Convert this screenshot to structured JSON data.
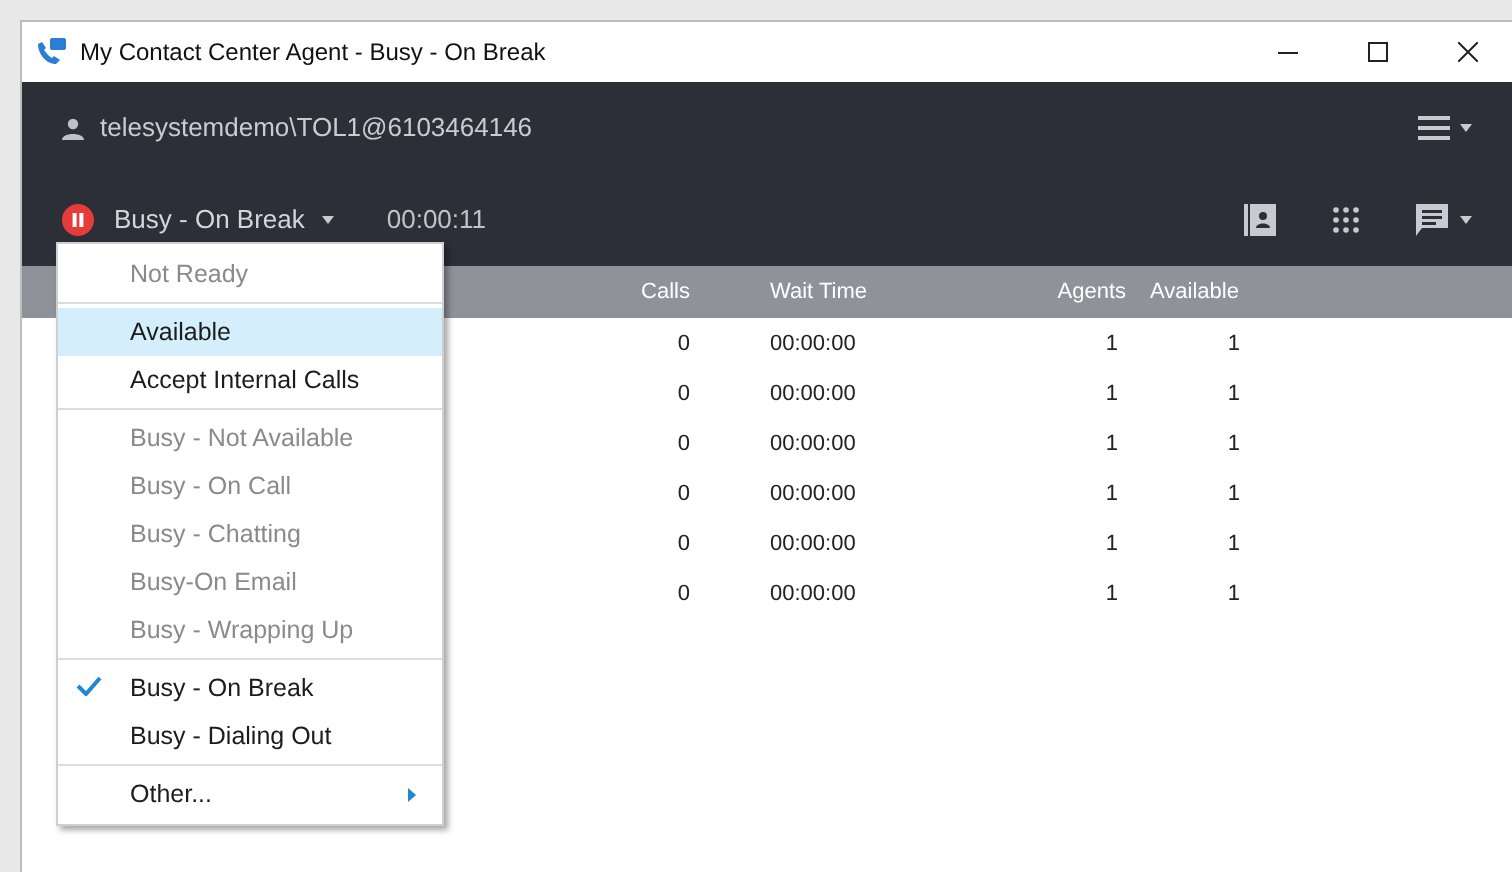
{
  "window": {
    "title": "My Contact Center Agent - Busy - On Break"
  },
  "header": {
    "user": "telesystemdemo\\TOL1@6103464146",
    "status": "Busy - On Break",
    "timer": "00:00:11"
  },
  "table": {
    "columns": [
      "Calls",
      "Wait Time",
      "Agents",
      "Available"
    ],
    "rows": [
      [
        "0",
        "00:00:00",
        "1",
        "1"
      ],
      [
        "0",
        "00:00:00",
        "1",
        "1"
      ],
      [
        "0",
        "00:00:00",
        "1",
        "1"
      ],
      [
        "0",
        "00:00:00",
        "1",
        "1"
      ],
      [
        "0",
        "00:00:00",
        "1",
        "1"
      ],
      [
        "0",
        "00:00:00",
        "1",
        "1"
      ]
    ]
  },
  "status_menu": {
    "groups": [
      [
        {
          "label": "Not Ready",
          "disabled": true,
          "checked": false,
          "highlighted": false,
          "submenu": false
        }
      ],
      [
        {
          "label": "Available",
          "disabled": false,
          "checked": false,
          "highlighted": true,
          "submenu": false
        },
        {
          "label": "Accept Internal Calls",
          "disabled": false,
          "checked": false,
          "highlighted": false,
          "submenu": false
        }
      ],
      [
        {
          "label": "Busy - Not Available",
          "disabled": true,
          "checked": false,
          "highlighted": false,
          "submenu": false
        },
        {
          "label": "Busy - On Call",
          "disabled": true,
          "checked": false,
          "highlighted": false,
          "submenu": false
        },
        {
          "label": "Busy - Chatting",
          "disabled": true,
          "checked": false,
          "highlighted": false,
          "submenu": false
        },
        {
          "label": "Busy-On Email",
          "disabled": true,
          "checked": false,
          "highlighted": false,
          "submenu": false
        },
        {
          "label": "Busy - Wrapping Up",
          "disabled": true,
          "checked": false,
          "highlighted": false,
          "submenu": false
        }
      ],
      [
        {
          "label": "Busy - On Break",
          "disabled": false,
          "checked": true,
          "highlighted": false,
          "submenu": false
        },
        {
          "label": "Busy - Dialing Out",
          "disabled": false,
          "checked": false,
          "highlighted": false,
          "submenu": false
        }
      ],
      [
        {
          "label": "Other...",
          "disabled": false,
          "checked": false,
          "highlighted": false,
          "submenu": true
        }
      ]
    ]
  }
}
